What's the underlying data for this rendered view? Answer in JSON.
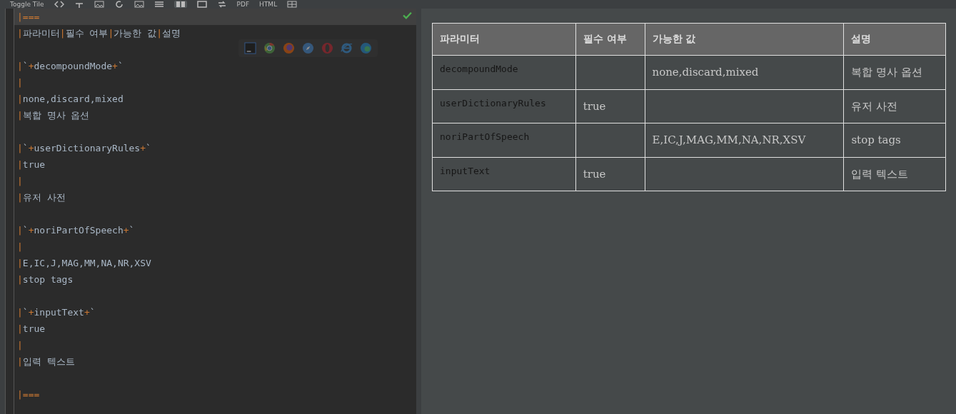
{
  "toolbar": {
    "items": [
      {
        "kind": "text",
        "label": "Toggle Tile"
      },
      {
        "kind": "icon",
        "selected": false
      },
      {
        "kind": "icon",
        "selected": false
      },
      {
        "kind": "icon",
        "selected": false
      },
      {
        "kind": "icon",
        "selected": false
      },
      {
        "kind": "icon",
        "selected": false
      },
      {
        "kind": "icon",
        "selected": false
      },
      {
        "kind": "icon",
        "selected": true
      },
      {
        "kind": "icon",
        "selected": false
      },
      {
        "kind": "icon",
        "selected": false
      },
      {
        "kind": "text",
        "label": "PDF"
      },
      {
        "kind": "text",
        "label": "HTML"
      },
      {
        "kind": "icon",
        "selected": false
      }
    ]
  },
  "editor": {
    "valid": true,
    "lines": [
      {
        "kind": "text",
        "text": "|===",
        "current": true
      },
      {
        "kind": "text",
        "text": "|파라미터|필수 여부|가능한 값|설명",
        "current": false
      },
      {
        "kind": "blank"
      },
      {
        "kind": "text",
        "text": "|`+decompoundMode+`",
        "current": false
      },
      {
        "kind": "text",
        "text": "|",
        "current": false
      },
      {
        "kind": "text",
        "text": "|none,discard,mixed",
        "current": false
      },
      {
        "kind": "text",
        "text": "|복합 명사 옵션",
        "current": false
      },
      {
        "kind": "blank"
      },
      {
        "kind": "text",
        "text": "|`+userDictionaryRules+`",
        "current": false
      },
      {
        "kind": "text",
        "text": "|true",
        "current": false
      },
      {
        "kind": "text",
        "text": "|",
        "current": false
      },
      {
        "kind": "text",
        "text": "|유저 사전",
        "current": false
      },
      {
        "kind": "blank"
      },
      {
        "kind": "text",
        "text": "|`+noriPartOfSpeech+`",
        "current": false
      },
      {
        "kind": "text",
        "text": "|",
        "current": false
      },
      {
        "kind": "text",
        "text": "|E,IC,J,MAG,MM,NA,NR,XSV",
        "current": false
      },
      {
        "kind": "text",
        "text": "|stop tags",
        "current": false
      },
      {
        "kind": "blank"
      },
      {
        "kind": "text",
        "text": "|`+inputText+`",
        "current": false
      },
      {
        "kind": "text",
        "text": "|true",
        "current": false
      },
      {
        "kind": "text",
        "text": "|",
        "current": false
      },
      {
        "kind": "text",
        "text": "|입력 텍스트",
        "current": false
      },
      {
        "kind": "blank"
      },
      {
        "kind": "text",
        "text": "|===",
        "current": false
      }
    ]
  },
  "preview": {
    "table": {
      "columns": [
        "파라미터",
        "필수 여부",
        "가능한 값",
        "설명"
      ],
      "rows": [
        {
          "cells": [
            {
              "kind": "code",
              "text": "decompoundMode"
            },
            {
              "kind": "empty"
            },
            {
              "kind": "text",
              "text": "none,discard,mixed"
            },
            {
              "kind": "text",
              "text": "복합 명사 옵션"
            }
          ]
        },
        {
          "cells": [
            {
              "kind": "code",
              "text": "userDictionaryRules"
            },
            {
              "kind": "text",
              "text": "true"
            },
            {
              "kind": "empty"
            },
            {
              "kind": "text",
              "text": "유저 사전"
            }
          ]
        },
        {
          "cells": [
            {
              "kind": "code",
              "text": "noriPartOfSpeech"
            },
            {
              "kind": "empty"
            },
            {
              "kind": "text",
              "text": "E,IC,J,MAG,MM,NA,NR,XSV"
            },
            {
              "kind": "text",
              "text": "stop tags"
            }
          ]
        },
        {
          "cells": [
            {
              "kind": "code",
              "text": "inputText"
            },
            {
              "kind": "text",
              "text": "true"
            },
            {
              "kind": "empty"
            },
            {
              "kind": "text",
              "text": "입력 텍스트"
            }
          ]
        }
      ]
    }
  }
}
